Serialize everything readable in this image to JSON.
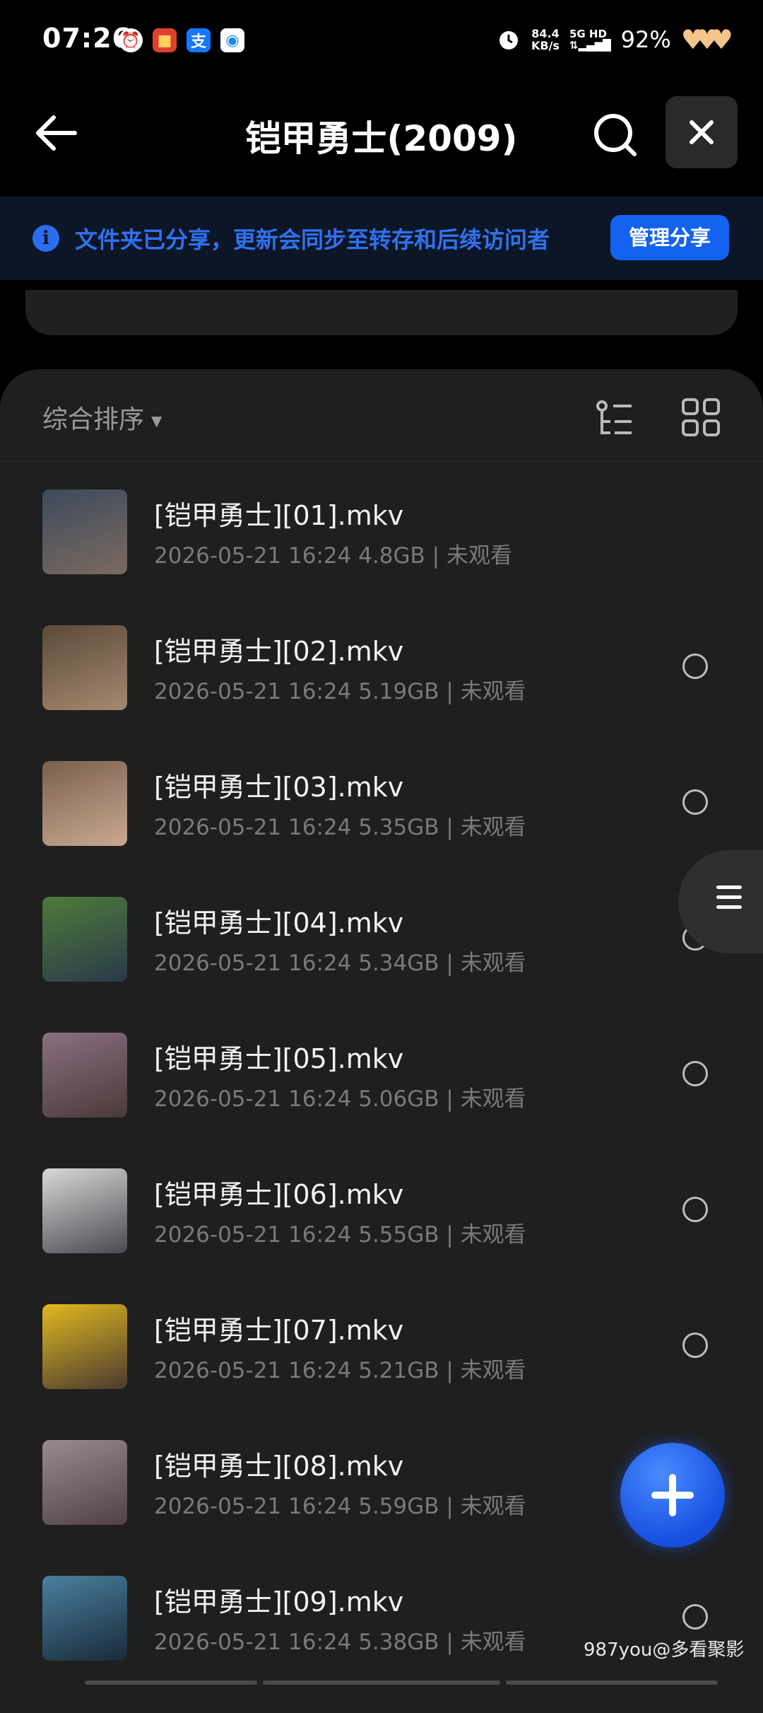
{
  "status_bar": {
    "time": "07:26",
    "net_speed_value": "84.4",
    "net_speed_unit": "KB/s",
    "signal": "5G HD",
    "battery": "92%"
  },
  "header": {
    "title": "铠甲勇士(2009)"
  },
  "banner": {
    "text": "文件夹已分享，更新会同步至转存和后续访问者",
    "button": "管理分享"
  },
  "toolbar": {
    "sort_label": "综合排序"
  },
  "files": [
    {
      "name": "[铠甲勇士][01].mkv",
      "date": "2026-05-21 16:24",
      "size": "4.8GB",
      "status": "未观看",
      "thumb_colors": [
        "#3d4a5c",
        "#7b6a60"
      ]
    },
    {
      "name": "[铠甲勇士][02].mkv",
      "date": "2026-05-21 16:24",
      "size": "5.19GB",
      "status": "未观看",
      "thumb_colors": [
        "#5b4a3a",
        "#a58970"
      ]
    },
    {
      "name": "[铠甲勇士][03].mkv",
      "date": "2026-05-21 16:24",
      "size": "5.35GB",
      "status": "未观看",
      "thumb_colors": [
        "#7a6050",
        "#c9a890"
      ]
    },
    {
      "name": "[铠甲勇士][04].mkv",
      "date": "2026-05-21 16:24",
      "size": "5.34GB",
      "status": "未观看",
      "thumb_colors": [
        "#4f7a3a",
        "#2a3a4a"
      ]
    },
    {
      "name": "[铠甲勇士][05].mkv",
      "date": "2026-05-21 16:24",
      "size": "5.06GB",
      "status": "未观看",
      "thumb_colors": [
        "#8a7080",
        "#4a3a3a"
      ]
    },
    {
      "name": "[铠甲勇士][06].mkv",
      "date": "2026-05-21 16:24",
      "size": "5.55GB",
      "status": "未观看",
      "thumb_colors": [
        "#d8d8d8",
        "#4a4a50"
      ]
    },
    {
      "name": "[铠甲勇士][07].mkv",
      "date": "2026-05-21 16:24",
      "size": "5.21GB",
      "status": "未观看",
      "thumb_colors": [
        "#e0b820",
        "#4a3a30"
      ]
    },
    {
      "name": "[铠甲勇士][08].mkv",
      "date": "2026-05-21 16:24",
      "size": "5.59GB",
      "status": "未观看",
      "thumb_colors": [
        "#9a8a90",
        "#504048"
      ]
    },
    {
      "name": "[铠甲勇士][09].mkv",
      "date": "2026-05-21 16:24",
      "size": "5.38GB",
      "status": "未观看",
      "thumb_colors": [
        "#4a80a0",
        "#1a2a3a"
      ]
    }
  ],
  "watermark": "987you@多看聚影"
}
